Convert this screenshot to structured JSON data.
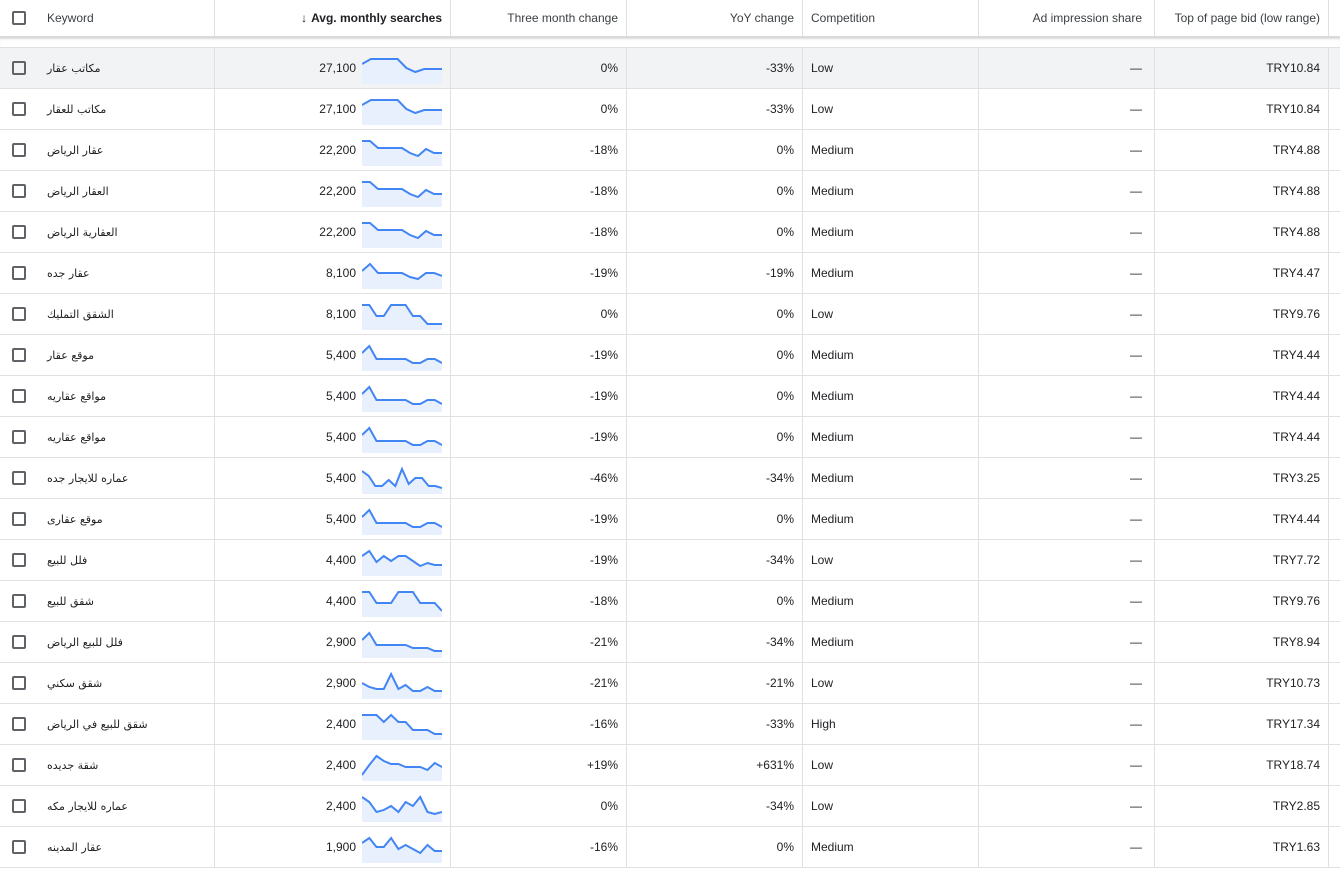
{
  "header": {
    "keyword": "Keyword",
    "avg_monthly_searches": "Avg. monthly searches",
    "sort_arrow": "↓",
    "three_month_change": "Three month change",
    "yoy_change": "YoY change",
    "competition": "Competition",
    "ad_impression_share": "Ad impression share",
    "top_bid_low": "Top of page bid (low range)"
  },
  "colors": {
    "sparkline_stroke": "#4285f4",
    "sparkline_fill": "#e8f0fe",
    "highlight_row": "#f1f3f4"
  },
  "rows": [
    {
      "keyword": "مكاتب عقار",
      "searches": "27,100",
      "three": "0%",
      "yoy": "-33%",
      "comp": "Low",
      "ais": "—",
      "bid": "TRY10.84",
      "trend": [
        8,
        3,
        3,
        3,
        3,
        12,
        16,
        13,
        13,
        13
      ]
    },
    {
      "keyword": "مكاتب للعقار",
      "searches": "27,100",
      "three": "0%",
      "yoy": "-33%",
      "comp": "Low",
      "ais": "—",
      "bid": "TRY10.84",
      "trend": [
        8,
        3,
        3,
        3,
        3,
        12,
        16,
        13,
        13,
        13
      ]
    },
    {
      "keyword": "عقار الرياض",
      "searches": "22,200",
      "three": "-18%",
      "yoy": "0%",
      "comp": "Medium",
      "ais": "—",
      "bid": "TRY4.88",
      "trend": [
        3,
        3,
        10,
        10,
        10,
        10,
        15,
        18,
        11,
        15,
        15
      ]
    },
    {
      "keyword": "العقار الرياض",
      "searches": "22,200",
      "three": "-18%",
      "yoy": "0%",
      "comp": "Medium",
      "ais": "—",
      "bid": "TRY4.88",
      "trend": [
        3,
        3,
        10,
        10,
        10,
        10,
        15,
        18,
        11,
        15,
        15
      ]
    },
    {
      "keyword": "العقارية الرياض",
      "searches": "22,200",
      "three": "-18%",
      "yoy": "0%",
      "comp": "Medium",
      "ais": "—",
      "bid": "TRY4.88",
      "trend": [
        3,
        3,
        10,
        10,
        10,
        10,
        15,
        18,
        11,
        15,
        15
      ]
    },
    {
      "keyword": "عقار جده",
      "searches": "8,100",
      "three": "-19%",
      "yoy": "-19%",
      "comp": "Medium",
      "ais": "—",
      "bid": "TRY4.47",
      "trend": [
        10,
        3,
        12,
        12,
        12,
        12,
        16,
        18,
        12,
        12,
        15
      ]
    },
    {
      "keyword": "الشقق التمليك",
      "searches": "8,100",
      "three": "0%",
      "yoy": "0%",
      "comp": "Low",
      "ais": "—",
      "bid": "TRY9.76",
      "trend": [
        3,
        3,
        14,
        14,
        3,
        3,
        3,
        14,
        14,
        22,
        22,
        22
      ]
    },
    {
      "keyword": "موقع عقار",
      "searches": "5,400",
      "three": "-19%",
      "yoy": "0%",
      "comp": "Medium",
      "ais": "—",
      "bid": "TRY4.44",
      "trend": [
        10,
        3,
        16,
        16,
        16,
        16,
        16,
        20,
        20,
        16,
        16,
        20
      ]
    },
    {
      "keyword": "مواقع عقاريه",
      "searches": "5,400",
      "three": "-19%",
      "yoy": "0%",
      "comp": "Medium",
      "ais": "—",
      "bid": "TRY4.44",
      "trend": [
        10,
        3,
        16,
        16,
        16,
        16,
        16,
        20,
        20,
        16,
        16,
        20
      ]
    },
    {
      "keyword": "مواقع عقاريه",
      "searches": "5,400",
      "three": "-19%",
      "yoy": "0%",
      "comp": "Medium",
      "ais": "—",
      "bid": "TRY4.44",
      "trend": [
        10,
        3,
        16,
        16,
        16,
        16,
        16,
        20,
        20,
        16,
        16,
        20
      ]
    },
    {
      "keyword": "عماره للايجار جده",
      "searches": "5,400",
      "three": "-46%",
      "yoy": "-34%",
      "comp": "Medium",
      "ais": "—",
      "bid": "TRY3.25",
      "trend": [
        5,
        10,
        20,
        20,
        14,
        20,
        3,
        18,
        12,
        12,
        20,
        20,
        22
      ]
    },
    {
      "keyword": "موقع عقارى",
      "searches": "5,400",
      "three": "-19%",
      "yoy": "0%",
      "comp": "Medium",
      "ais": "—",
      "bid": "TRY4.44",
      "trend": [
        10,
        3,
        16,
        16,
        16,
        16,
        16,
        20,
        20,
        16,
        16,
        20
      ]
    },
    {
      "keyword": "فلل للبيع",
      "searches": "4,400",
      "three": "-19%",
      "yoy": "-34%",
      "comp": "Low",
      "ais": "—",
      "bid": "TRY7.72",
      "trend": [
        8,
        3,
        14,
        8,
        13,
        8,
        8,
        13,
        18,
        15,
        17,
        17
      ]
    },
    {
      "keyword": "شقق للبيع",
      "searches": "4,400",
      "three": "-18%",
      "yoy": "0%",
      "comp": "Medium",
      "ais": "—",
      "bid": "TRY9.76",
      "trend": [
        3,
        3,
        14,
        14,
        14,
        3,
        3,
        3,
        14,
        14,
        14,
        22
      ]
    },
    {
      "keyword": "فلل للبيع الرياض",
      "searches": "2,900",
      "three": "-21%",
      "yoy": "-34%",
      "comp": "Medium",
      "ais": "—",
      "bid": "TRY8.94",
      "trend": [
        10,
        3,
        15,
        15,
        15,
        15,
        15,
        18,
        18,
        18,
        21,
        21
      ]
    },
    {
      "keyword": "شقق سكني",
      "searches": "2,900",
      "three": "-21%",
      "yoy": "-21%",
      "comp": "Low",
      "ais": "—",
      "bid": "TRY10.73",
      "trend": [
        12,
        16,
        18,
        18,
        3,
        18,
        14,
        20,
        20,
        16,
        20,
        20
      ]
    },
    {
      "keyword": "شقق للبيع في الرياض",
      "searches": "2,400",
      "three": "-16%",
      "yoy": "-33%",
      "comp": "High",
      "ais": "—",
      "bid": "TRY17.34",
      "trend": [
        3,
        3,
        3,
        10,
        3,
        10,
        10,
        18,
        18,
        18,
        22,
        22
      ]
    },
    {
      "keyword": "شقة جديده",
      "searches": "2,400",
      "three": "+19%",
      "yoy": "+631%",
      "comp": "Low",
      "ais": "—",
      "bid": "TRY18.74",
      "trend": [
        22,
        12,
        3,
        8,
        11,
        11,
        14,
        14,
        14,
        17,
        10,
        14
      ]
    },
    {
      "keyword": "عماره للايجار مكه",
      "searches": "2,400",
      "three": "0%",
      "yoy": "-34%",
      "comp": "Low",
      "ais": "—",
      "bid": "TRY2.85",
      "trend": [
        3,
        8,
        18,
        16,
        12,
        18,
        8,
        12,
        3,
        18,
        20,
        18
      ]
    },
    {
      "keyword": "عقار المدينه",
      "searches": "1,900",
      "three": "-16%",
      "yoy": "0%",
      "comp": "Medium",
      "ais": "—",
      "bid": "TRY1.63",
      "trend": [
        8,
        3,
        12,
        12,
        3,
        14,
        10,
        14,
        18,
        10,
        16,
        16
      ]
    }
  ]
}
